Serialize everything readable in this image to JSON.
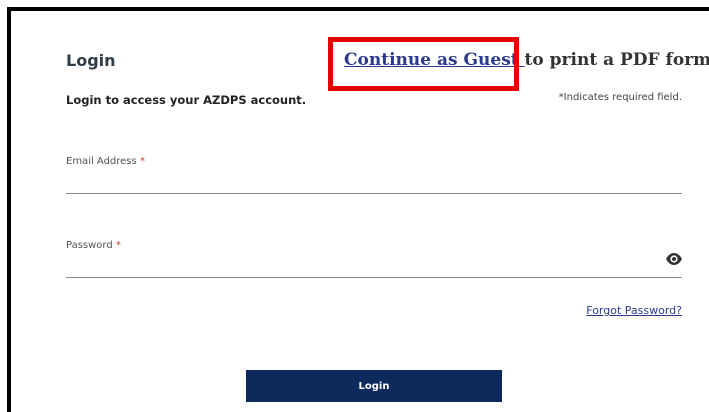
{
  "header": {
    "title": "Login",
    "guest_link": "Continue as Guest ",
    "guest_suffix": "to print a PDF form"
  },
  "form": {
    "subtitle": "Login to access your AZDPS account.",
    "required_note": "*Indicates required field.",
    "email": {
      "label": "Email Address",
      "required_mark": "*",
      "value": ""
    },
    "password": {
      "label": "Password",
      "required_mark": "*",
      "value": ""
    },
    "forgot_link": "Forgot Password?",
    "submit_label": "Login"
  },
  "icons": {
    "password_toggle": "eye-icon"
  },
  "colors": {
    "link": "#2b3a8f",
    "button_bg": "#0d2a5c",
    "required_star": "#c0392b",
    "highlight": "#e60000"
  }
}
